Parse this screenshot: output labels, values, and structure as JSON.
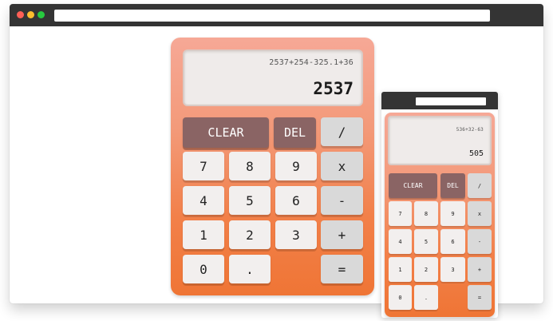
{
  "desktop_calculator": {
    "display": {
      "expression": "2537+254-325.1+36",
      "result": "2537"
    },
    "keys": {
      "clear": "CLEAR",
      "del": "DEL",
      "divide": "/",
      "seven": "7",
      "eight": "8",
      "nine": "9",
      "multiply": "x",
      "four": "4",
      "five": "5",
      "six": "6",
      "subtract": "-",
      "one": "1",
      "two": "2",
      "three": "3",
      "add": "+",
      "zero": "0",
      "decimal": ".",
      "equals": "="
    }
  },
  "mobile_calculator": {
    "display": {
      "expression": "536+32-63",
      "result": "505"
    },
    "keys": {
      "clear": "CLEAR",
      "del": "DEL",
      "divide": "/",
      "seven": "7",
      "eight": "8",
      "nine": "9",
      "multiply": "x",
      "four": "4",
      "five": "5",
      "six": "6",
      "subtract": "-",
      "one": "1",
      "two": "2",
      "three": "3",
      "add": "+",
      "zero": "0",
      "decimal": ".",
      "equals": "="
    }
  },
  "colors": {
    "gradient_top": "#f6a896",
    "gradient_bottom": "#ef7535",
    "function_key": "#8a6464",
    "number_key": "#f2efee",
    "operator_key": "#d9d9d9",
    "browser_bar": "#343434"
  }
}
